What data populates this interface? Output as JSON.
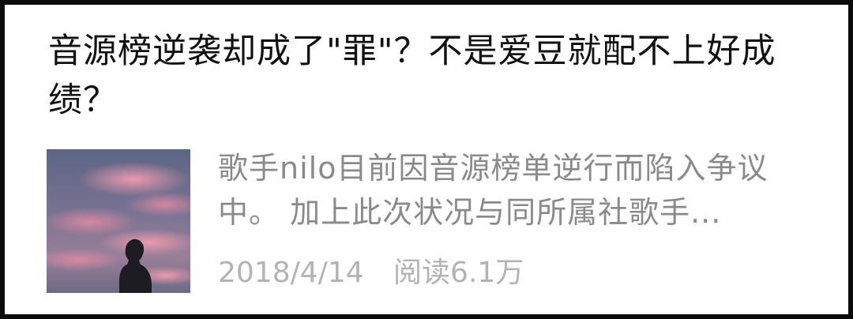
{
  "article": {
    "title": "音源榜逆袭却成了\"罪\"？不是爱豆就配不上好成绩？",
    "excerpt": "歌手nilo目前因音源榜单逆行而陷入争议中。 加上此次状况与同所属社歌手...",
    "date": "2018/4/14",
    "reads": "阅读6.1万",
    "thumbnail": "silhouette-sunset-image"
  },
  "colors": {
    "title": "#111111",
    "excerpt": "#8a8a8a",
    "meta": "#b3b3b3",
    "border": "#0b0b0b"
  }
}
